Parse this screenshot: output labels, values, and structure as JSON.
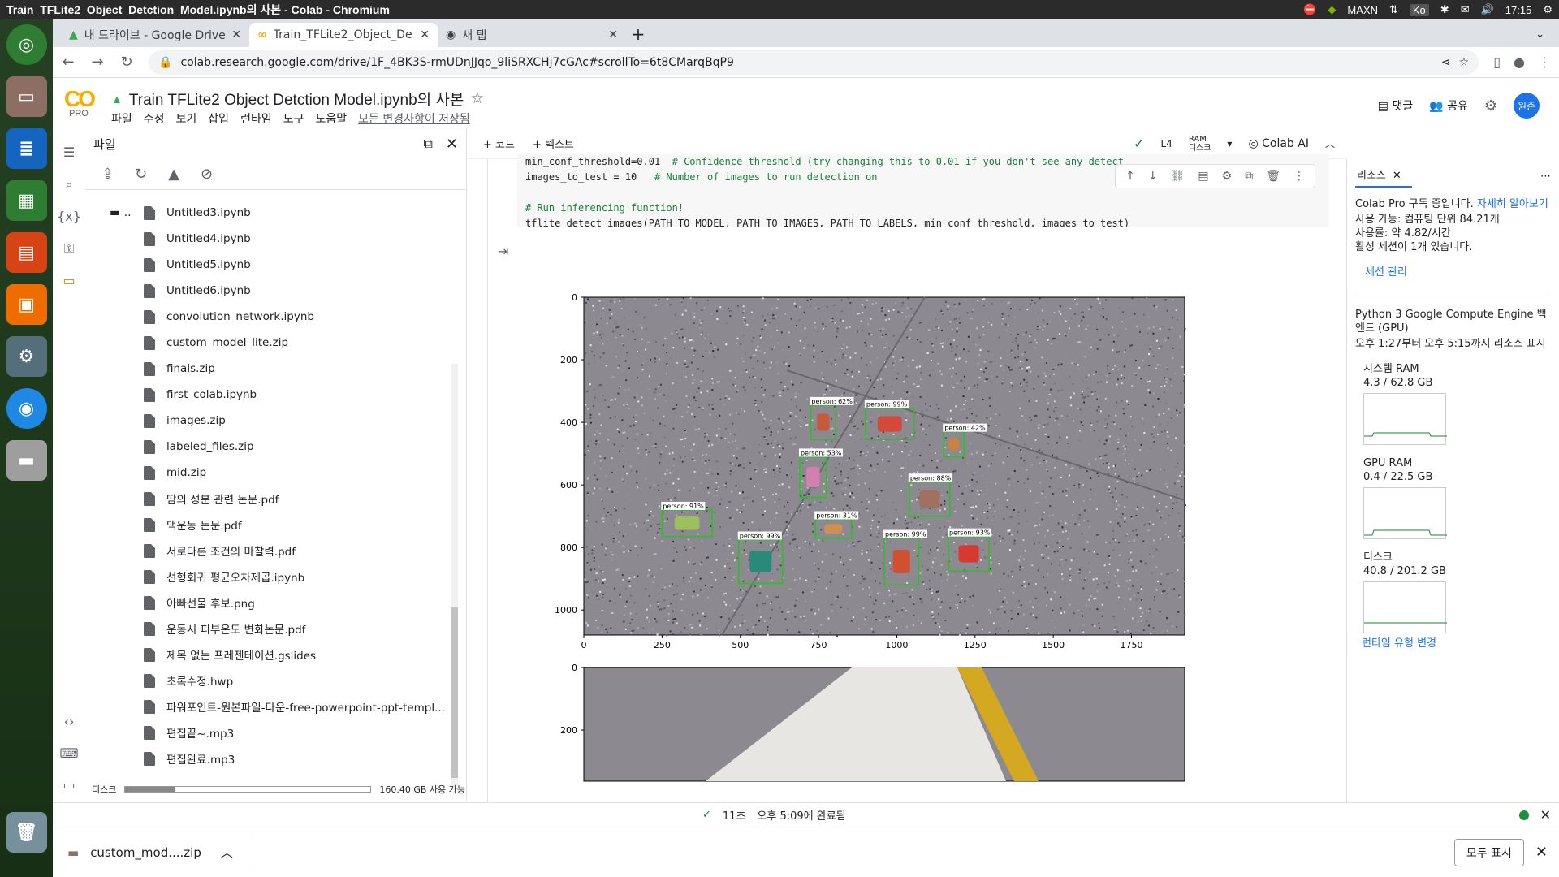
{
  "window_title": "Train_TFLite2_Object_Detction_Model.ipynb의 사본 - Colab - Chromium",
  "tray": {
    "gpu": "MAXN",
    "lang": "Ko",
    "time": "17:15"
  },
  "tabs": [
    {
      "label": "내 드라이브 - Google Drive",
      "icon": "drive-icon"
    },
    {
      "label": "Train_TFLite2_Object_De",
      "icon": "colab-icon"
    },
    {
      "label": "새 탭",
      "icon": "chrome-icon"
    }
  ],
  "address": {
    "url": "colab.research.google.com/drive/1F_4BK3S-rmUDnJJqo_9liSRXCHj7cGAc#scrollTo=6t8CMarqBqP9"
  },
  "colab": {
    "logo_text": "CO",
    "pro": "PRO",
    "notebook_title": "Train TFLite2 Object Detction Model.ipynb의 사본",
    "menus": [
      "파일",
      "수정",
      "보기",
      "삽입",
      "런타임",
      "도구",
      "도움말"
    ],
    "saved_status": "모든 변경사항이 저장됨",
    "comment": "댓글",
    "share": "공유",
    "avatar": "원준"
  },
  "files_panel": {
    "title": "파일",
    "parent": "..",
    "items": [
      "Untitled3.ipynb",
      "Untitled4.ipynb",
      "Untitled5.ipynb",
      "Untitled6.ipynb",
      "convolution_network.ipynb",
      "custom_model_lite.zip",
      "finals.zip",
      "first_colab.ipynb",
      "images.zip",
      "labeled_files.zip",
      "mid.zip",
      "땀의 성분 관련 논문.pdf",
      "맥운동 논문.pdf",
      "서로다른 조건의 마찰력.pdf",
      "선형회귀 평균오차제곱.ipynb",
      "아빠선물 후보.png",
      "운동시 피부온도 변화논문.pdf",
      "제목 없는 프레젠테이션.gslides",
      "초록수정.hwp",
      "파워포인트-원본파일-다운-free-powerpoint-ppt-templ...",
      "편집끝~.mp3",
      "편집완료.mp3"
    ],
    "disk_label": "디스크",
    "disk_usage": "160.40 GB 사용 가능",
    "disk_fraction": 0.2
  },
  "toolbar": {
    "code": "+ 코드",
    "text": "+ 텍스트",
    "runtime": "L4",
    "ram": "RAM",
    "disk": "디스크",
    "colab_ai": "Colab AI"
  },
  "code_cell": {
    "lines": [
      {
        "code": "min_conf_threshold=0.01",
        "comment": "  # Confidence threshold (try changing this to 0.01 if you don't see any detect"
      },
      {
        "code": "images_to_test = 10",
        "comment": "   # Number of images to run detection on"
      },
      {
        "code": "",
        "comment": ""
      },
      {
        "code": "",
        "comment": "# Run inferencing function!"
      },
      {
        "code": "tflite_detect_images(PATH_TO_MODEL, PATH_TO_IMAGES, PATH_TO_LABELS, min_conf_threshold, images_to_test)",
        "comment": ""
      }
    ]
  },
  "plot": {
    "x_ticks": [
      "0",
      "250",
      "500",
      "750",
      "1000",
      "1250",
      "1500",
      "1750"
    ],
    "y_ticks": [
      "0",
      "200",
      "400",
      "600",
      "800",
      "1000"
    ],
    "y_ticks_second": [
      "0",
      "200"
    ],
    "detections": [
      {
        "label": "person: 62%",
        "x": 725,
        "y": 345,
        "w": 80,
        "h": 110
      },
      {
        "label": "person: 99%",
        "x": 900,
        "y": 355,
        "w": 155,
        "h": 100
      },
      {
        "label": "person: 42%",
        "x": 1150,
        "y": 430,
        "w": 65,
        "h": 80
      },
      {
        "label": "person: 53%",
        "x": 690,
        "y": 510,
        "w": 85,
        "h": 130
      },
      {
        "label": "person: 88%",
        "x": 1040,
        "y": 590,
        "w": 130,
        "h": 110
      },
      {
        "label": "person: 91%",
        "x": 250,
        "y": 680,
        "w": 160,
        "h": 85
      },
      {
        "label": "person: 31%",
        "x": 740,
        "y": 710,
        "w": 115,
        "h": 60
      },
      {
        "label": "person: 99%",
        "x": 495,
        "y": 775,
        "w": 140,
        "h": 140
      },
      {
        "label": "person: 99%",
        "x": 960,
        "y": 770,
        "w": 110,
        "h": 150
      },
      {
        "label": "person: 93%",
        "x": 1165,
        "y": 765,
        "w": 130,
        "h": 110
      }
    ]
  },
  "resources": {
    "tab": "리소스",
    "sub": "Colab Pro 구독 중입니다.",
    "learn_more": "자세히 알아보기",
    "units": "사용 가능: 컴퓨팅 단위 84.21개",
    "rate": "사용률: 약 4.82/시간",
    "sessions": "활성 세션이 1개 있습니다.",
    "manage": "세션 관리",
    "backend": "Python 3 Google Compute Engine 백엔드 (GPU)",
    "shown": "오후 1:27부터 오후 5:15까지 리소스 표시",
    "ram_label": "시스템 RAM",
    "ram_value": "4.3 / 62.8 GB",
    "gpu_label": "GPU RAM",
    "gpu_value": "0.4 / 22.5 GB",
    "disk_label": "디스크",
    "disk_value": "40.8 / 201.2 GB",
    "change_runtime": "런타임 유형 변경"
  },
  "status": {
    "duration": "11초",
    "completed": "오후 5:09에 완료됨"
  },
  "download": {
    "file": "custom_mod....zip",
    "show_all": "모두 표시"
  }
}
